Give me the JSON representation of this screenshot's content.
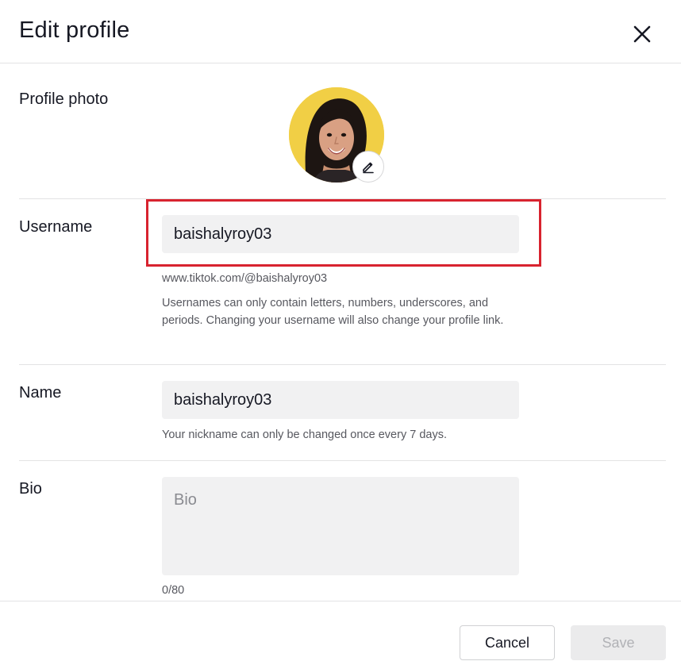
{
  "header": {
    "title": "Edit profile",
    "close_icon": "close-icon"
  },
  "profile_photo": {
    "label": "Profile photo",
    "edit_icon": "pencil-icon"
  },
  "username": {
    "label": "Username",
    "value": "baishalyroy03",
    "url": "www.tiktok.com/@baishalyroy03",
    "description": "Usernames can only contain letters, numbers, underscores, and periods. Changing your username will also change your profile link."
  },
  "name": {
    "label": "Name",
    "value": "baishalyroy03",
    "hint": "Your nickname can only be changed once every 7 days."
  },
  "bio": {
    "label": "Bio",
    "placeholder": "Bio",
    "count": "0/80"
  },
  "footer": {
    "cancel_label": "Cancel",
    "save_label": "Save"
  },
  "colors": {
    "highlight": "#d8232f",
    "avatar_background": "#f1cf45",
    "input_background": "#f1f1f2"
  }
}
